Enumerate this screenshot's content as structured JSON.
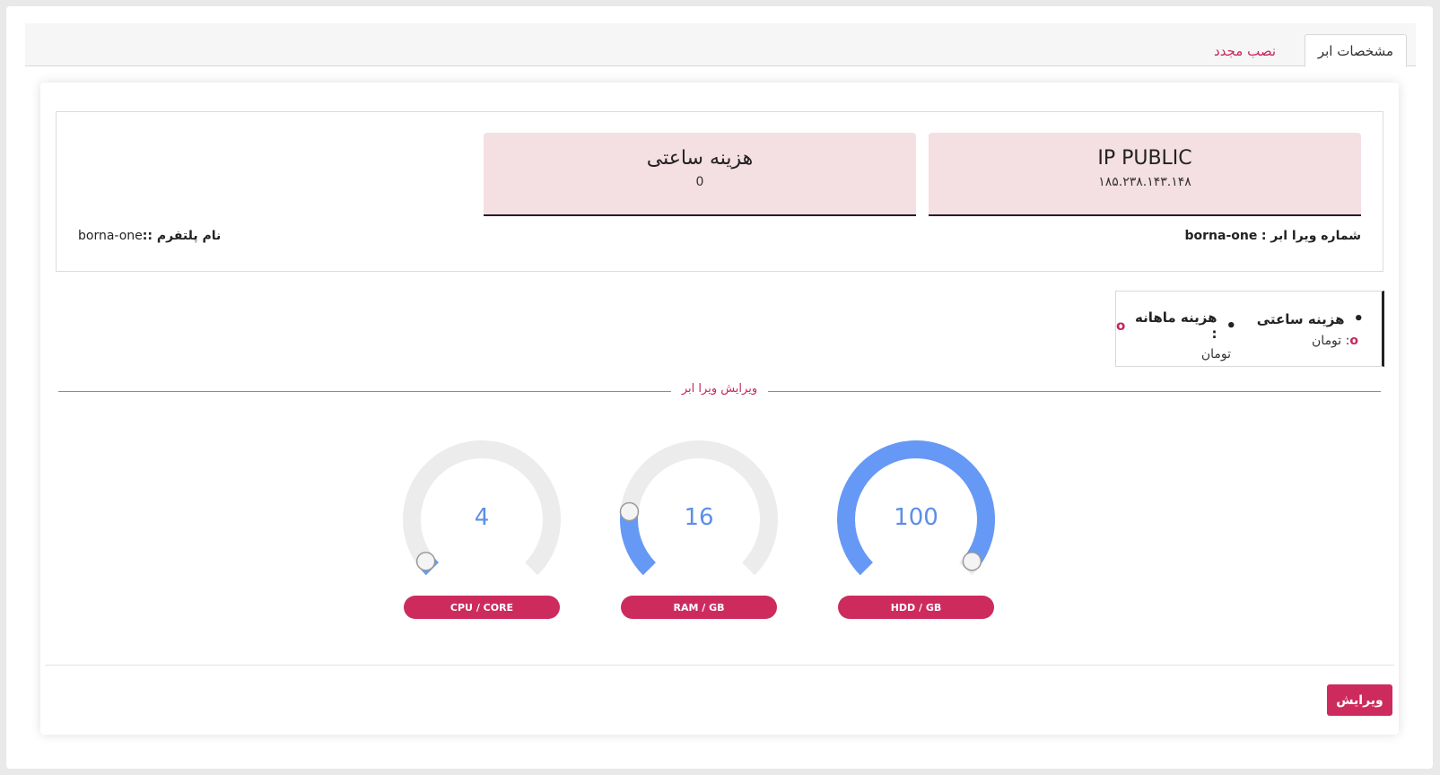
{
  "tabs": [
    {
      "label": "مشخصات ابر",
      "active": true
    },
    {
      "label": "نصب مجدد",
      "active": false
    }
  ],
  "stats": {
    "ip": {
      "title": "IP PUBLIC",
      "value": "۱۸۵.۲۳۸.۱۴۳.۱۴۸"
    },
    "hourly_cost": {
      "title": "هزینه ساعتی",
      "value": "0"
    }
  },
  "meta": {
    "vira_number_label": "شماره ویرا ابر :",
    "vira_number_value": "borna-one",
    "platform_label": "نام پلتفرم ::",
    "platform_value": "borna-one"
  },
  "pricing": {
    "hourly_label": "هزینه ساعتی",
    "hourly_sub": "تومان",
    "monthly_label": "هزینه ماهانه :",
    "monthly_sub": "تومان",
    "dot_symbol": "o"
  },
  "section_title": "ویرایش ویرا ابر",
  "gauges": [
    {
      "key": "hdd",
      "value": "100",
      "label": "HDD / GB",
      "fraction": 0.97
    },
    {
      "key": "ram",
      "value": "16",
      "label": "RAM / GB",
      "fraction": 0.19
    },
    {
      "key": "cpu",
      "value": "4",
      "label": "CPU / CORE",
      "fraction": 0.03
    }
  ],
  "colors": {
    "accent": "#cd2b5e",
    "gauge_fill": "#6699f5",
    "gauge_track": "#ececec",
    "stat_bg": "#f4dfe3"
  },
  "actions": {
    "edit_label": "ویرایش"
  }
}
